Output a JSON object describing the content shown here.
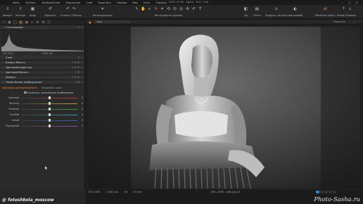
{
  "menubar": {
    "items": [
      "Файл",
      "Экспорт",
      "Изображение",
      "Коррекция",
      "Слой",
      "Выделить",
      "Камера",
      "Вид",
      "Окно",
      "Справка"
    ],
    "window_title": "2020-10-08 - Alpha - Trial - Edit",
    "controls": [
      "–",
      "□",
      "✕"
    ]
  },
  "toolbar": {
    "import_label": "Импорт",
    "export_label": "Экспорт",
    "library_label": "Кадр",
    "reset_label": "Сбросить",
    "undo_label": "Отмена / Повтор",
    "autocorrect_label": "Автокоррекция",
    "cursor_tools_label": "Инструменты курсора",
    "before_label": "До",
    "grid_label": "Сетка",
    "warning_label": "Предупр. об эксп.",
    "proof_label": "Цветопроба",
    "edit_selected_label": "Изменить выб-е",
    "copy_apply_label": "Копир./Примен."
  },
  "left_panel": {
    "tool_tabs": [
      "folder",
      "camera",
      "circle",
      "layers",
      "crop",
      "search",
      "i"
    ],
    "histogram": {
      "title": "Гистограмма",
      "iso": "ISO 2500",
      "shutter": "1/160 сек"
    },
    "sections": [
      "Слои",
      "Баланс белого",
      "Цветовой редактор",
      "Цветовой баланс",
      "Кривая",
      "Черно-белые изображения"
    ],
    "bw": {
      "tab_sensitivity": "Цветовая чувствительность",
      "tab_split": "Разделить тона",
      "checkbox_label": "Включить черно-белые изображения",
      "checkbox_checked": true,
      "sliders": [
        {
          "label": "Красный",
          "value": "0",
          "pos": 0.5,
          "color": "#c0392b"
        },
        {
          "label": "Желтый",
          "value": "0",
          "pos": 0.5,
          "color": "#c7a53a"
        },
        {
          "label": "Зеленый",
          "value": "0",
          "pos": 0.5,
          "color": "#4b9b4b"
        },
        {
          "label": "Голубой",
          "value": "0",
          "pos": 0.5,
          "color": "#3e9fae"
        },
        {
          "label": "Синий",
          "value": "0",
          "pos": 0.5,
          "color": "#3c5fc0"
        },
        {
          "label": "Пурпурный",
          "value": "0",
          "pos": 0.5,
          "color": "#a24cae"
        }
      ]
    }
  },
  "viewer": {
    "preset_value": "Фон",
    "fit_label": "Уместить"
  },
  "infobar": {
    "iso": "ISO 2500",
    "shutter": "1/160 сек",
    "aperture": "f/4",
    "focal": "50 mm",
    "filename": "IMG_4086 - edit.jpg [2]",
    "watermark": "Photo-Sasha.ru",
    "handle": "@ fotoshkola_moscow"
  },
  "colors": {
    "accent": "#ff8a2a",
    "panel": "#2a2a2a",
    "selection": "#2f7fd4"
  }
}
